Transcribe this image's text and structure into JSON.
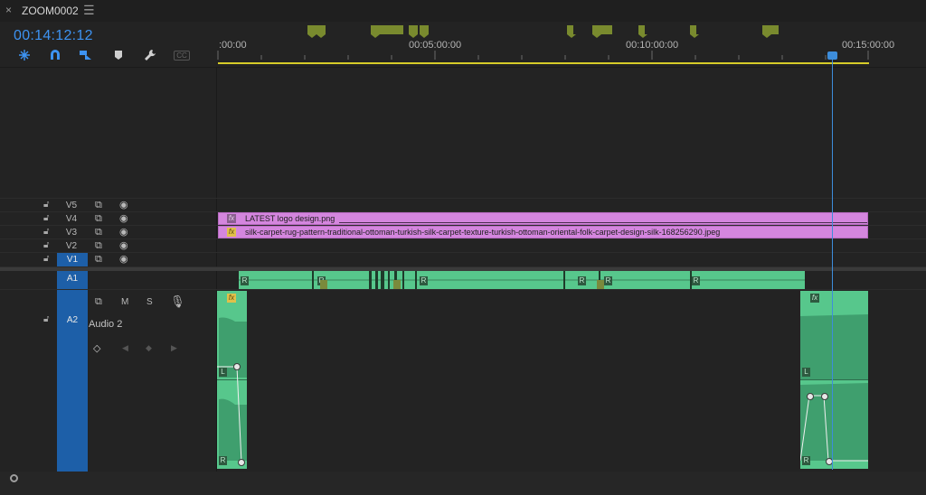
{
  "panel": {
    "close_label": "×",
    "title": "ZOOM0002",
    "menu_icon": "hamburger-icon"
  },
  "timecode": "00:14:12:12",
  "toolbar": {
    "icons": [
      "snap-ripple-icon",
      "magnet-icon",
      "linked-selection-icon",
      "marker-icon",
      "wrench-icon",
      "cc-icon"
    ],
    "cc_label": "CC"
  },
  "ruler": {
    "labels": [
      ":00:00",
      "00:05:00:00",
      "00:10:00:00",
      "00:15:00:00"
    ]
  },
  "video_tracks": [
    {
      "name": "V5"
    },
    {
      "name": "V4"
    },
    {
      "name": "V3"
    },
    {
      "name": "V2"
    },
    {
      "name": "V1"
    }
  ],
  "audio_tracks": [
    {
      "name": "A1"
    },
    {
      "name": "A2",
      "label": "Audio 2",
      "buttons": [
        "M",
        "S"
      ]
    }
  ],
  "clips": {
    "v4": {
      "name": "LATEST logo design.png",
      "badge": "fx"
    },
    "v3": {
      "name": "silk-carpet-rug-pattern-traditional-ottoman-turkish-silk-carpet-texture-turkish-ottoman-oriental-folk-carpet-design-silk-168256290.jpeg",
      "badge": "fx"
    },
    "a2_left_badge": "fx",
    "a2_right_badge": "fx",
    "channel_l": "L",
    "channel_r": "R",
    "a1_badge": "R"
  },
  "colors": {
    "accent_blue": "#3d93f2",
    "marker_olive": "#798a2e",
    "workarea_yellow": "#d6cc29",
    "video_clip_pink": "#d486de",
    "audio_clip_green": "#57c78c",
    "track_target_blue": "#1d5fa8"
  }
}
